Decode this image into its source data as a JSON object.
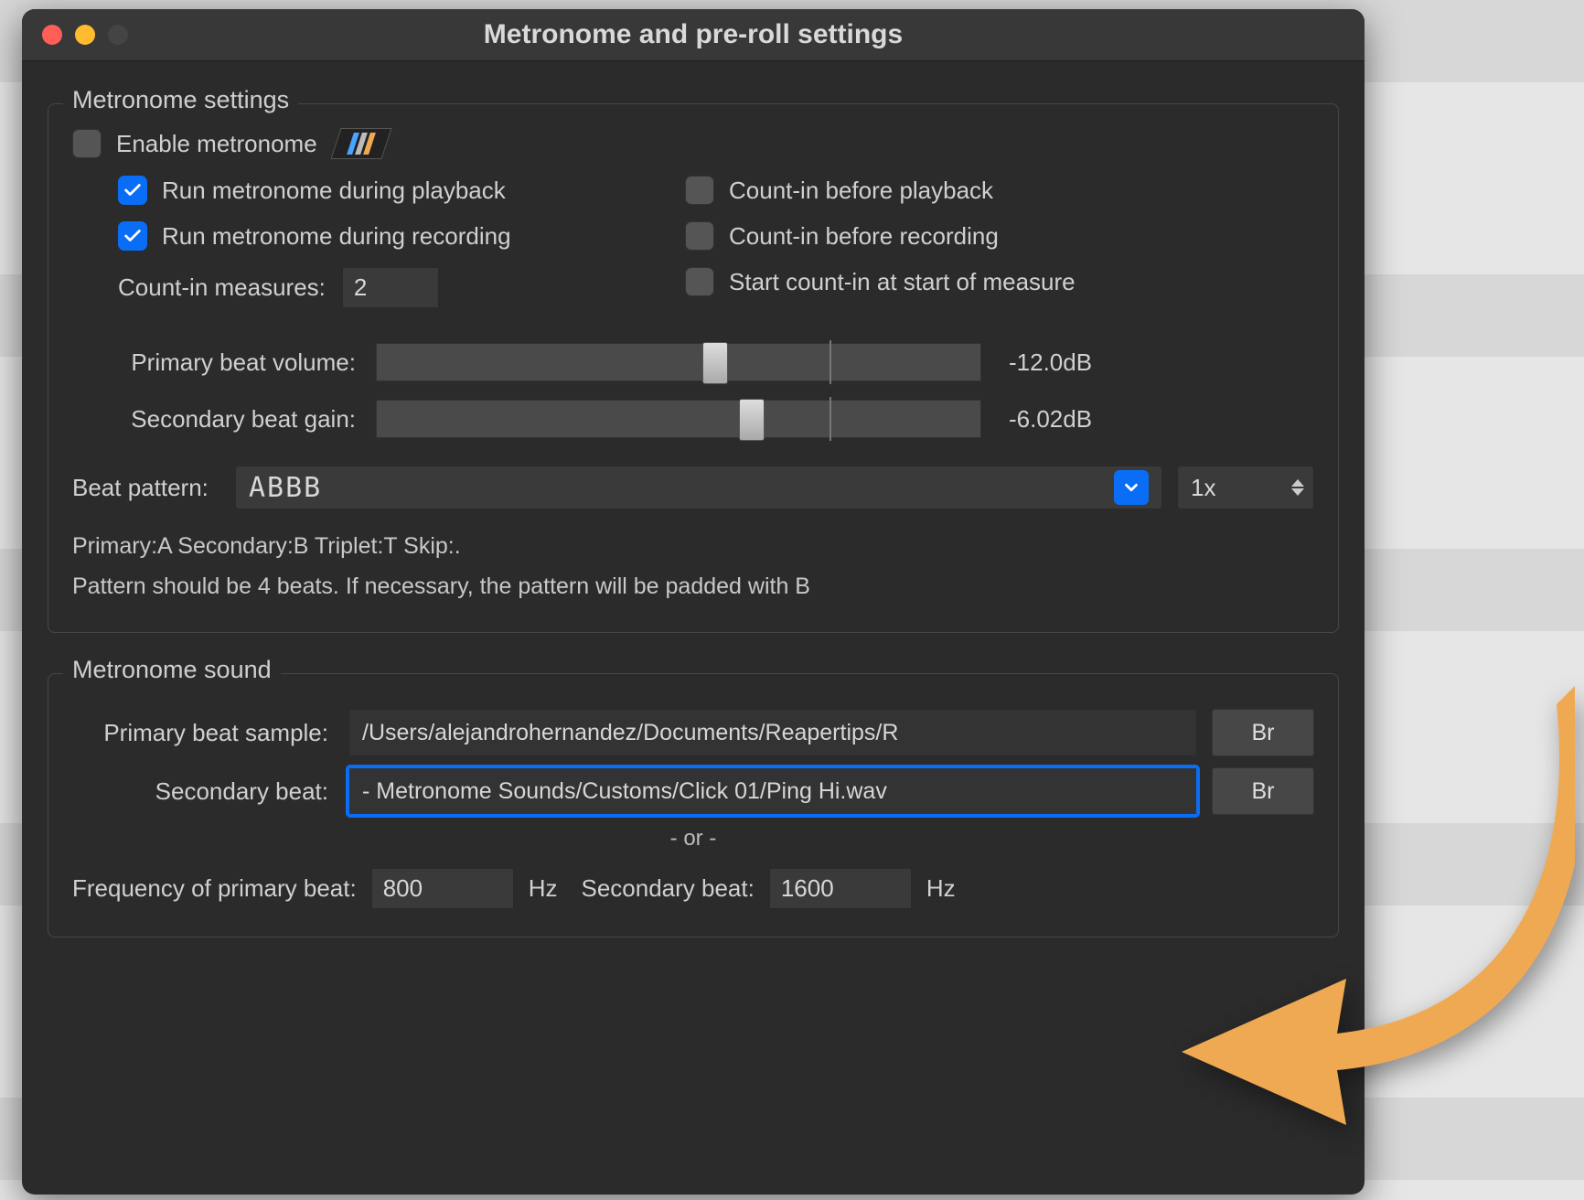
{
  "window": {
    "title": "Metronome and pre-roll settings"
  },
  "sections": {
    "settings": {
      "title": "Metronome settings",
      "enable_label": "Enable metronome",
      "run_playback_label": "Run metronome during playback",
      "run_recording_label": "Run metronome during recording",
      "countin_playback_label": "Count-in before playback",
      "countin_recording_label": "Count-in before recording",
      "start_measure_label": "Start count-in at start of measure",
      "countin_measures_label": "Count-in measures:",
      "countin_measures_value": "2",
      "primary_vol_label": "Primary beat volume:",
      "primary_vol_value": "-12.0dB",
      "secondary_gain_label": "Secondary beat gain:",
      "secondary_gain_value": "-6.02dB",
      "beat_pattern_label": "Beat pattern:",
      "beat_pattern_value": "ABBB",
      "multiplier_value": "1x",
      "hint1": "Primary:A Secondary:B Triplet:T Skip:.",
      "hint2": "Pattern should be 4 beats. If necessary, the pattern will be padded with B"
    },
    "sound": {
      "title": "Metronome sound",
      "primary_sample_label": "Primary beat sample:",
      "primary_sample_value": "/Users/alejandrohernandez/Documents/Reapertips/R",
      "secondary_sample_label": "Secondary beat:",
      "secondary_sample_value": "- Metronome Sounds/Customs/Click 01/Ping Hi.wav",
      "browse_label": "Br",
      "or_label": "- or -",
      "freq_primary_label": "Frequency of primary beat:",
      "freq_primary_value": "800",
      "hz_label": "Hz",
      "freq_secondary_label": "Secondary beat:",
      "freq_secondary_value": "1600"
    }
  },
  "checkbox_states": {
    "enable": false,
    "run_playback": true,
    "run_recording": true,
    "countin_playback": false,
    "countin_recording": false,
    "start_measure": false
  },
  "slider_positions": {
    "primary_pct": 54,
    "secondary_pct": 60,
    "tick_pct": 75
  },
  "colors": {
    "accent": "#0a6df5",
    "arrow": "#f0a953"
  }
}
